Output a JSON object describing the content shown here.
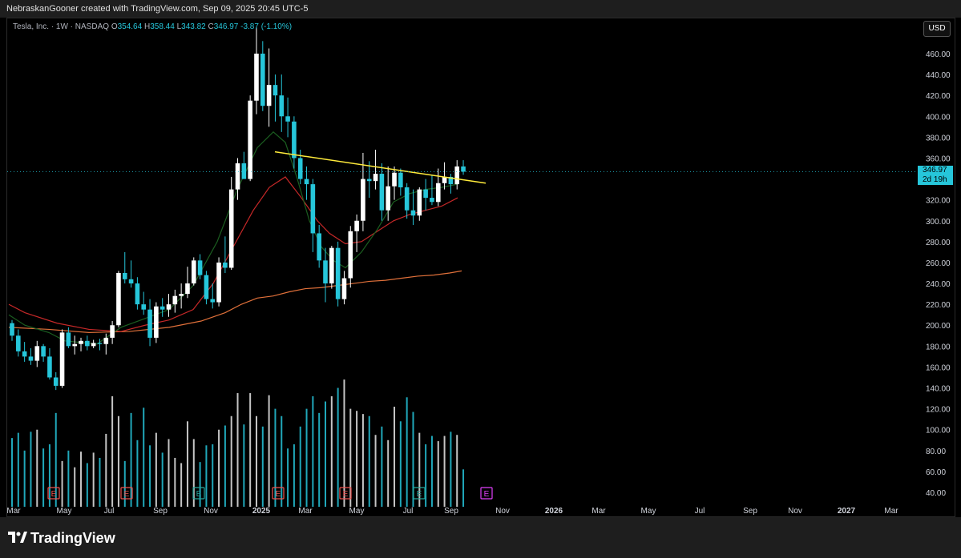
{
  "header": {
    "credit": "NebraskanGooner created with TradingView.com, Sep 09, 2025 20:45 UTC-5"
  },
  "legend": {
    "symbol": "Tesla, Inc. · 1W · NASDAQ",
    "o_label": "O",
    "o_value": "354.64",
    "h_label": "H",
    "h_value": "358.44",
    "l_label": "L",
    "l_value": "343.82",
    "c_label": "C",
    "c_value": "346.97",
    "change": "-3.87 (-1.10%)"
  },
  "currency_button": "USD",
  "price_badge": {
    "price": "346.97",
    "countdown": "2d 19h"
  },
  "footer": {
    "brand": "TradingView"
  },
  "colors": {
    "up": "#ffffff",
    "down": "#26c6da",
    "trendline": "#ffeb3b",
    "ma_fast": "#1b5e20",
    "ma_mid": "#c62828",
    "ma_slow": "#e0703a",
    "earnings": "#ef5350",
    "earnings_alt": "#26a69a",
    "earnings_future": "#e040fb"
  },
  "chart_data": {
    "type": "candlestick",
    "title": "Tesla, Inc. · 1W · NASDAQ",
    "ylim": [
      30,
      478
    ],
    "y_ticks": [
      "460.00",
      "440.00",
      "420.00",
      "400.00",
      "380.00",
      "360.00",
      "340.00",
      "320.00",
      "300.00",
      "280.00",
      "260.00",
      "240.00",
      "220.00",
      "200.00",
      "180.00",
      "160.00",
      "140.00",
      "120.00",
      "100.00",
      "80.00",
      "60.00",
      "40.00"
    ],
    "x_labels": [
      "Mar",
      "May",
      "Jul",
      "Sep",
      "Nov",
      "2025",
      "Mar",
      "May",
      "Jul",
      "Sep",
      "Nov",
      "2026",
      "Mar",
      "May",
      "Jul",
      "Sep",
      "Nov",
      "2027",
      "Mar"
    ],
    "candles": [
      [
        202,
        205,
        185,
        190
      ],
      [
        190,
        196,
        170,
        175
      ],
      [
        175,
        184,
        165,
        170
      ],
      [
        170,
        178,
        162,
        166
      ],
      [
        166,
        185,
        160,
        180
      ],
      [
        180,
        182,
        165,
        170
      ],
      [
        170,
        178,
        148,
        150
      ],
      [
        150,
        155,
        138,
        142
      ],
      [
        142,
        196,
        140,
        193
      ],
      [
        193,
        198,
        178,
        180
      ],
      [
        180,
        190,
        172,
        182
      ],
      [
        182,
        188,
        175,
        185
      ],
      [
        185,
        190,
        176,
        180
      ],
      [
        180,
        186,
        178,
        183
      ],
      [
        183,
        187,
        176,
        182
      ],
      [
        182,
        192,
        172,
        188
      ],
      [
        188,
        204,
        182,
        200
      ],
      [
        200,
        252,
        198,
        250
      ],
      [
        250,
        270,
        240,
        244
      ],
      [
        244,
        262,
        236,
        240
      ],
      [
        240,
        246,
        215,
        220
      ],
      [
        220,
        232,
        210,
        215
      ],
      [
        215,
        225,
        180,
        188
      ],
      [
        188,
        222,
        183,
        218
      ],
      [
        218,
        226,
        208,
        215
      ],
      [
        215,
        230,
        208,
        220
      ],
      [
        220,
        234,
        212,
        228
      ],
      [
        228,
        240,
        216,
        230
      ],
      [
        230,
        256,
        226,
        240
      ],
      [
        240,
        265,
        238,
        262
      ],
      [
        262,
        268,
        244,
        248
      ],
      [
        248,
        252,
        220,
        225
      ],
      [
        225,
        240,
        216,
        222
      ],
      [
        222,
        265,
        218,
        260
      ],
      [
        260,
        285,
        250,
        255
      ],
      [
        255,
        342,
        253,
        330
      ],
      [
        330,
        360,
        320,
        355
      ],
      [
        355,
        366,
        340,
        340
      ],
      [
        340,
        420,
        338,
        415
      ],
      [
        415,
        485,
        402,
        460
      ],
      [
        460,
        472,
        405,
        410
      ],
      [
        410,
        465,
        390,
        430
      ],
      [
        430,
        440,
        395,
        420
      ],
      [
        420,
        440,
        385,
        400
      ],
      [
        400,
        418,
        380,
        395
      ],
      [
        395,
        400,
        350,
        360
      ],
      [
        360,
        368,
        335,
        340
      ],
      [
        340,
        352,
        320,
        335
      ],
      [
        335,
        340,
        270,
        288
      ],
      [
        288,
        296,
        255,
        262
      ],
      [
        262,
        274,
        222,
        240
      ],
      [
        240,
        276,
        235,
        274
      ],
      [
        274,
        280,
        218,
        225
      ],
      [
        225,
        252,
        220,
        245
      ],
      [
        245,
        295,
        236,
        290
      ],
      [
        290,
        306,
        270,
        300
      ],
      [
        300,
        365,
        290,
        340
      ],
      [
        340,
        357,
        322,
        338
      ],
      [
        338,
        368,
        330,
        345
      ],
      [
        345,
        355,
        300,
        310
      ],
      [
        310,
        352,
        300,
        333
      ],
      [
        333,
        352,
        320,
        346
      ],
      [
        346,
        350,
        324,
        332
      ],
      [
        332,
        336,
        302,
        310
      ],
      [
        310,
        330,
        296,
        305
      ],
      [
        305,
        332,
        300,
        330
      ],
      [
        330,
        340,
        310,
        322
      ],
      [
        322,
        344,
        315,
        318
      ],
      [
        318,
        350,
        314,
        336
      ],
      [
        336,
        356,
        330,
        342
      ],
      [
        342,
        345,
        326,
        335
      ],
      [
        335,
        358,
        330,
        352
      ],
      [
        352,
        358,
        344,
        347
      ]
    ],
    "volume": [
      92,
      97,
      80,
      98,
      100,
      82,
      86,
      116,
      70,
      80,
      64,
      79,
      68,
      78,
      73,
      96,
      132,
      113,
      70,
      116,
      90,
      121,
      85,
      97,
      78,
      91,
      73,
      68,
      108,
      91,
      69,
      85,
      86,
      100,
      104,
      113,
      135,
      105,
      135,
      113,
      103,
      133,
      120,
      113,
      82,
      86,
      103,
      120,
      132,
      116,
      127,
      132,
      140,
      148,
      120,
      118,
      115,
      113,
      95,
      103,
      90,
      122,
      108,
      131,
      117,
      97,
      86,
      94,
      89,
      94,
      98,
      95,
      62
    ],
    "ma_fast_path": [
      [
        0,
        210
      ],
      [
        20,
        200
      ],
      [
        50,
        193
      ],
      [
        70,
        185
      ],
      [
        110,
        182
      ],
      [
        140,
        198
      ],
      [
        165,
        205
      ],
      [
        200,
        215
      ],
      [
        230,
        238
      ],
      [
        260,
        280
      ],
      [
        285,
        330
      ],
      [
        310,
        370
      ],
      [
        330,
        385
      ],
      [
        345,
        375
      ],
      [
        360,
        340
      ],
      [
        375,
        300
      ],
      [
        390,
        275
      ],
      [
        405,
        262
      ],
      [
        420,
        255
      ],
      [
        440,
        270
      ],
      [
        460,
        292
      ],
      [
        480,
        318
      ],
      [
        500,
        326
      ],
      [
        520,
        330
      ],
      [
        540,
        332
      ],
      [
        560,
        335
      ]
    ],
    "ma_mid_path": [
      [
        0,
        220
      ],
      [
        20,
        212
      ],
      [
        60,
        202
      ],
      [
        100,
        196
      ],
      [
        140,
        194
      ],
      [
        170,
        200
      ],
      [
        200,
        205
      ],
      [
        230,
        215
      ],
      [
        255,
        240
      ],
      [
        280,
        275
      ],
      [
        305,
        310
      ],
      [
        325,
        332
      ],
      [
        345,
        342
      ],
      [
        365,
        322
      ],
      [
        385,
        300
      ],
      [
        400,
        288
      ],
      [
        420,
        278
      ],
      [
        440,
        280
      ],
      [
        460,
        290
      ],
      [
        480,
        300
      ],
      [
        500,
        306
      ],
      [
        520,
        310
      ],
      [
        540,
        314
      ],
      [
        560,
        322
      ]
    ],
    "ma_slow_path": [
      [
        0,
        198
      ],
      [
        50,
        196
      ],
      [
        100,
        193
      ],
      [
        150,
        194
      ],
      [
        200,
        198
      ],
      [
        240,
        204
      ],
      [
        270,
        212
      ],
      [
        290,
        220
      ],
      [
        310,
        226
      ],
      [
        330,
        228
      ],
      [
        350,
        232
      ],
      [
        370,
        235
      ],
      [
        390,
        236
      ],
      [
        410,
        238
      ],
      [
        430,
        240
      ],
      [
        450,
        242
      ],
      [
        470,
        243
      ],
      [
        490,
        245
      ],
      [
        510,
        247
      ],
      [
        530,
        248
      ],
      [
        550,
        250
      ],
      [
        565,
        252
      ]
    ],
    "trendline": [
      [
        342,
        366
      ],
      [
        605,
        336
      ]
    ],
    "earnings_markers": [
      {
        "label": "E",
        "x_index": 6
      },
      {
        "label": "E",
        "x_index": 19
      },
      {
        "label": "E",
        "x_index": 31
      },
      {
        "label": "E",
        "x_index": 44
      },
      {
        "label": "E",
        "x_index": 56
      },
      {
        "label": "E",
        "x_index": 69
      },
      {
        "label": "E",
        "x_index": 81
      }
    ],
    "current_price": 346.97
  }
}
